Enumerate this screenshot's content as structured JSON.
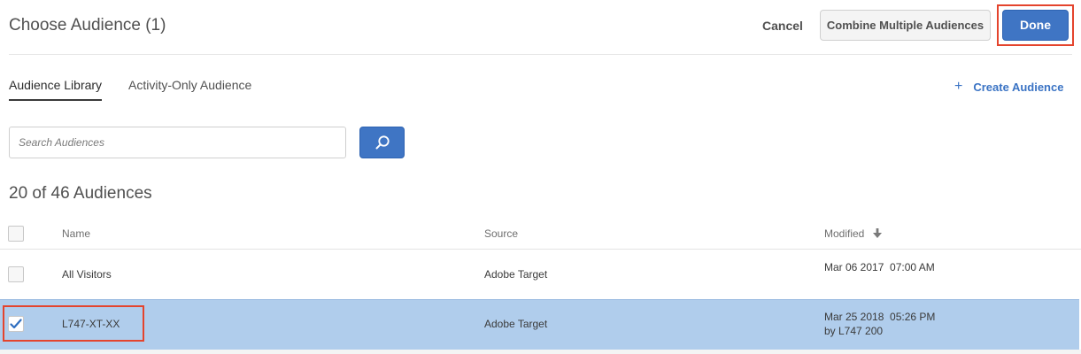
{
  "header": {
    "title": "Choose Audience (1)",
    "cancel_label": "Cancel",
    "combine_label": "Combine Multiple Audiences",
    "done_label": "Done"
  },
  "tabs": [
    {
      "label": "Audience Library",
      "active": true
    },
    {
      "label": "Activity-Only Audience",
      "active": false
    }
  ],
  "create": {
    "icon": "plus-icon",
    "label": "Create Audience"
  },
  "search": {
    "placeholder": "Search Audiences",
    "value": "",
    "icon": "search-icon"
  },
  "count_label": "20 of 46 Audiences",
  "table": {
    "columns": {
      "name": "Name",
      "source": "Source",
      "modified": "Modified",
      "sort_icon": "sort-down-arrow-icon"
    },
    "rows": [
      {
        "name": "All Visitors",
        "source": "Adobe Target",
        "modified": "Mar 06 2017  07:00 AM",
        "modified_by": "",
        "checked": false
      },
      {
        "name": "L747-XT-XX",
        "source": "Adobe Target",
        "modified": "Mar 25 2018  05:26 PM",
        "modified_by": "by L747 200",
        "checked": true
      }
    ]
  },
  "colors": {
    "primary": "#3f75c4",
    "selected_row": "#b0cdec",
    "highlight_outline": "#e4442d",
    "link": "#3a73c4"
  }
}
